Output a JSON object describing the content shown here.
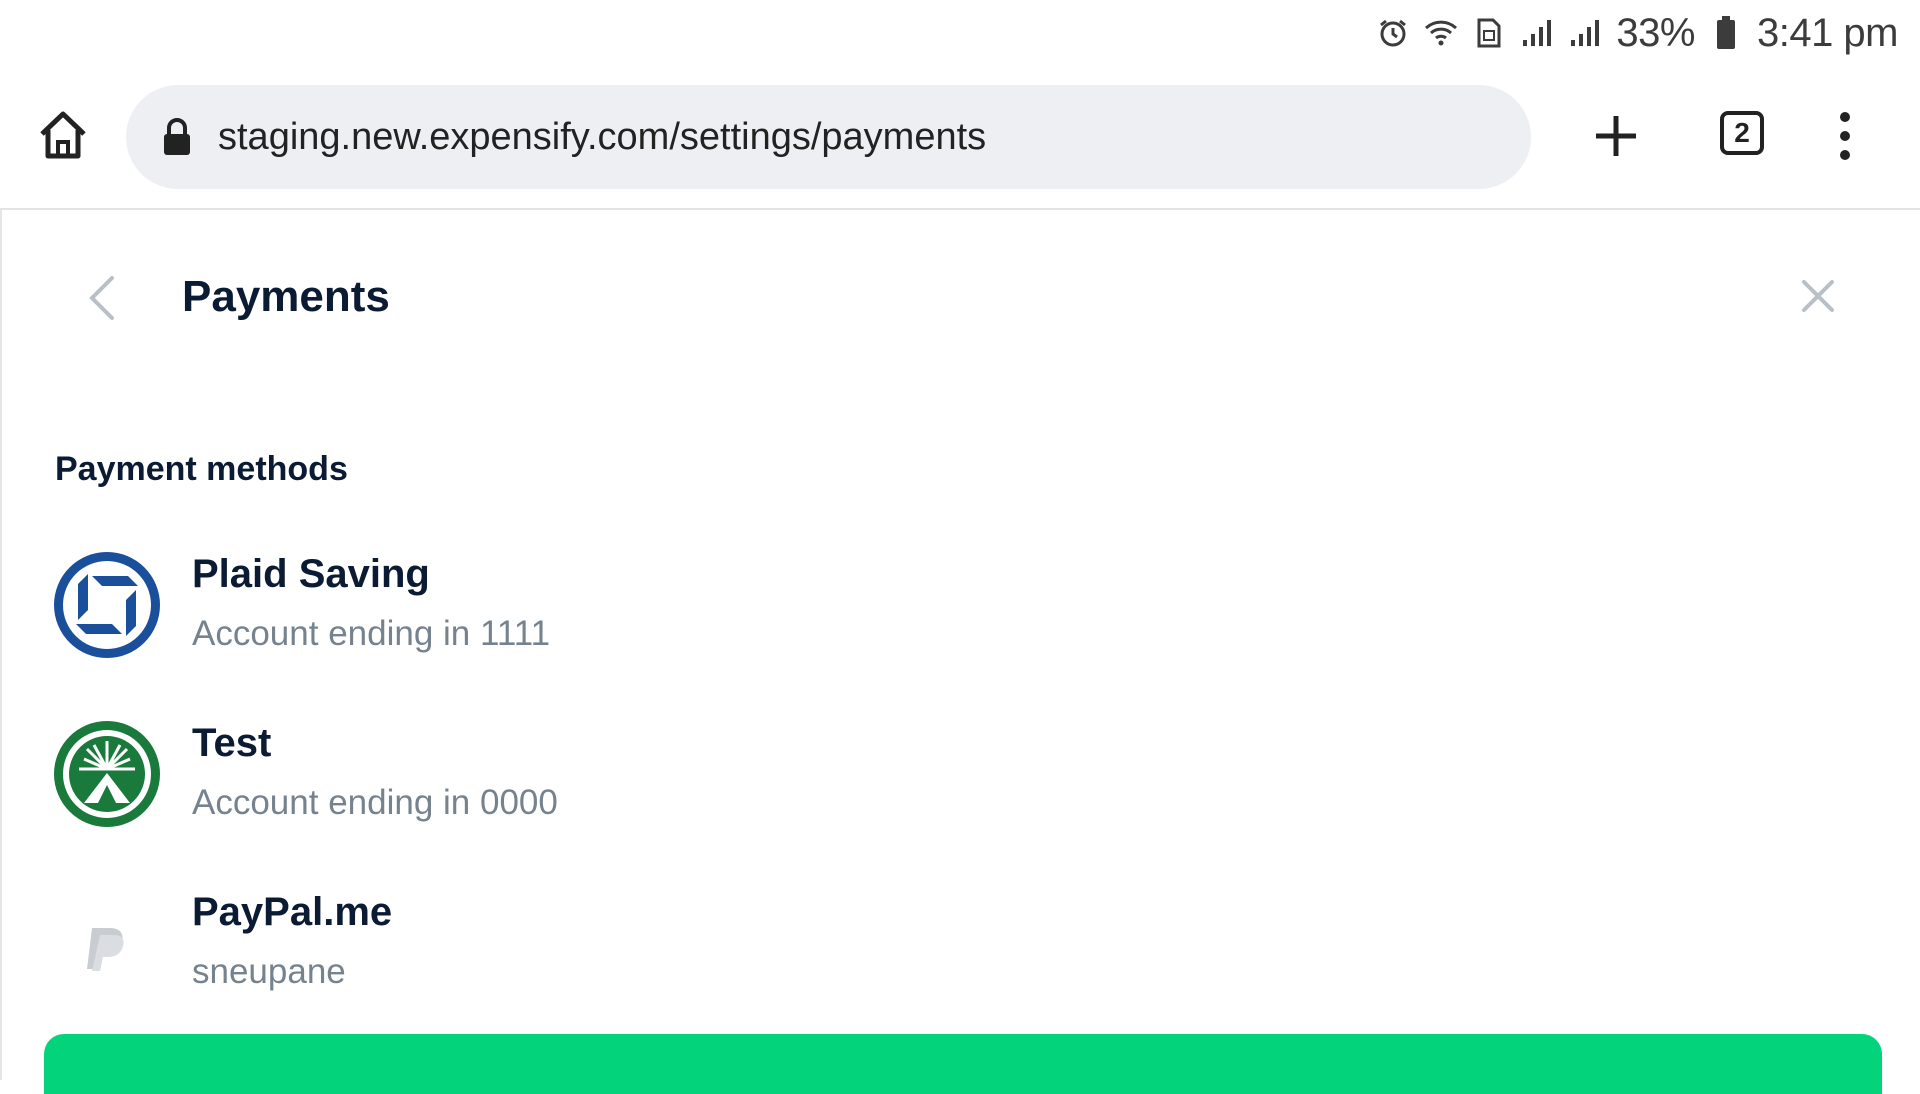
{
  "status_bar": {
    "battery_percent": "33%",
    "time": "3:41 pm",
    "icons": [
      "alarm-icon",
      "wifi-icon",
      "sim-icon",
      "signal-icon",
      "signal-icon",
      "battery-icon"
    ]
  },
  "browser": {
    "url": "staging.new.expensify.com/settings/payments",
    "tab_count": "2",
    "icons": [
      "home-icon",
      "lock-icon",
      "new-tab-icon",
      "tabs-icon",
      "more-menu-icon"
    ]
  },
  "header": {
    "title": "Payments"
  },
  "section": {
    "title": "Payment methods"
  },
  "payment_methods": [
    {
      "name": "Plaid Saving",
      "subtitle": "Account ending in 1111",
      "icon": "chase-bank-icon",
      "color": "#1a4f9c"
    },
    {
      "name": "Test",
      "subtitle": "Account ending in 0000",
      "icon": "fidelity-bank-icon",
      "color": "#1a7a3c"
    },
    {
      "name": "PayPal.me",
      "subtitle": "sneupane",
      "icon": "paypal-icon",
      "color": "#c9cdd2"
    }
  ],
  "colors": {
    "accent_green": "#03d47c",
    "text_dark": "#0b1b34",
    "text_muted": "#76838f",
    "url_bar_bg": "#eeeff3"
  }
}
